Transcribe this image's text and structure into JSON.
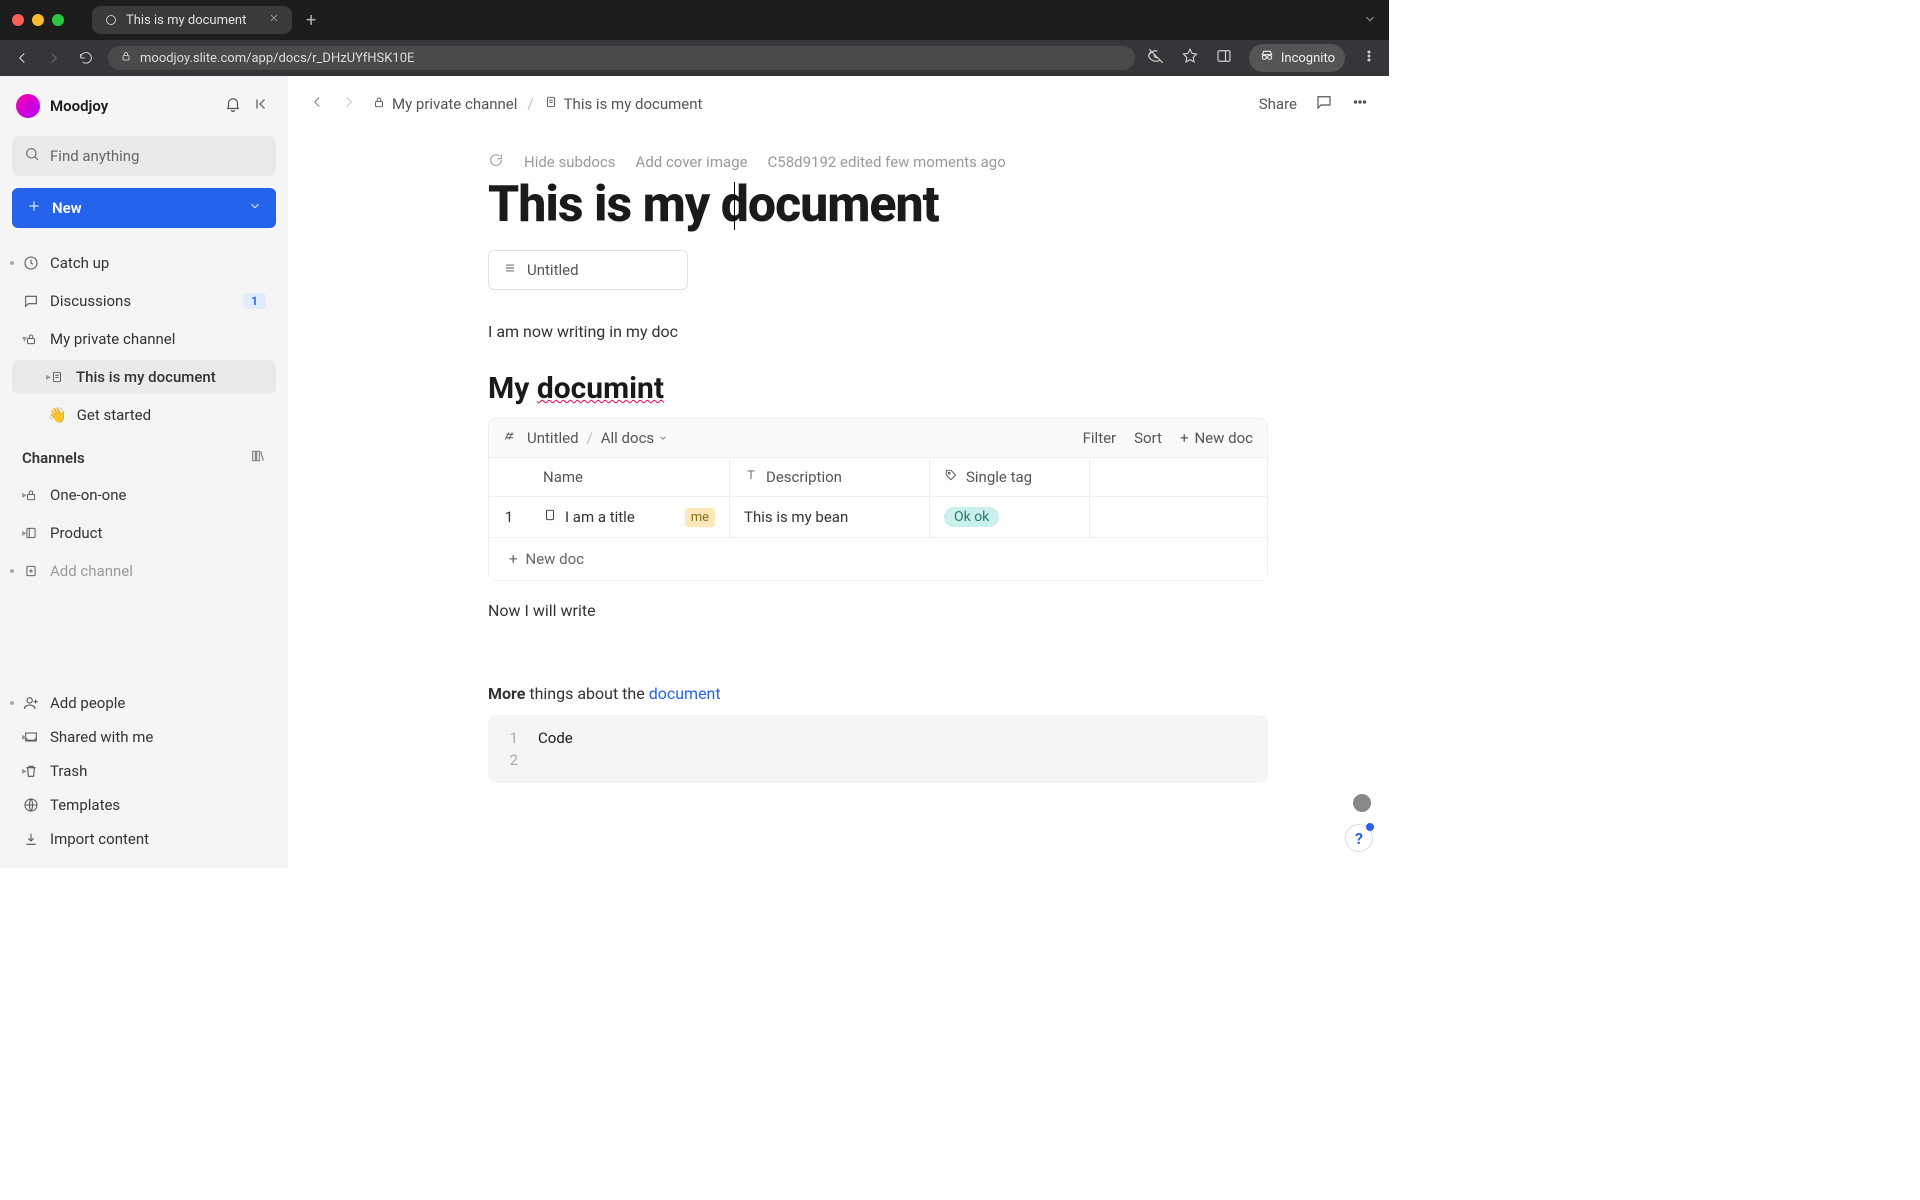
{
  "browser": {
    "tab_title": "This is my document",
    "url": "moodjoy.slite.com/app/docs/r_DHzUYfHSK10E",
    "incognito_label": "Incognito"
  },
  "workspace": {
    "name": "Moodjoy"
  },
  "search": {
    "placeholder": "Find anything"
  },
  "new_button": "New",
  "sidebar": {
    "catch_up": "Catch up",
    "discussions": "Discussions",
    "discussions_badge": "1",
    "private_channel": "My private channel",
    "doc_current": "This is my document",
    "get_started": "Get started",
    "channels_header": "Channels",
    "one_on_one": "One-on-one",
    "product": "Product",
    "add_channel": "Add channel",
    "add_people": "Add people",
    "shared_with_me": "Shared with me",
    "trash": "Trash",
    "templates": "Templates",
    "import_content": "Import content"
  },
  "topbar": {
    "crumb1": "My private channel",
    "crumb2": "This is my document",
    "share": "Share"
  },
  "doc": {
    "hide_subdocs": "Hide subdocs",
    "add_cover": "Add cover image",
    "edit_info": "C58d9192 edited few moments ago",
    "title": "This is my document",
    "subdoc_label": "Untitled",
    "para1": "I am now writing in my doc",
    "heading2_pre": "My ",
    "heading2_err": "documint",
    "para2": "Now I will write",
    "more_bold": "More",
    "more_mid": " things about the ",
    "more_link": "document",
    "code_line1": "Code"
  },
  "table": {
    "pathtitle": "Untitled",
    "pathall": "All docs",
    "filter": "Filter",
    "sort": "Sort",
    "newdoc": "New doc",
    "col_name": "Name",
    "col_desc": "Description",
    "col_tag": "Single tag",
    "row_num": "1",
    "row_name": "I am a title",
    "row_me": "me",
    "row_desc": "This is my bean",
    "row_tag": "Ok ok",
    "footer_new": "New doc"
  }
}
